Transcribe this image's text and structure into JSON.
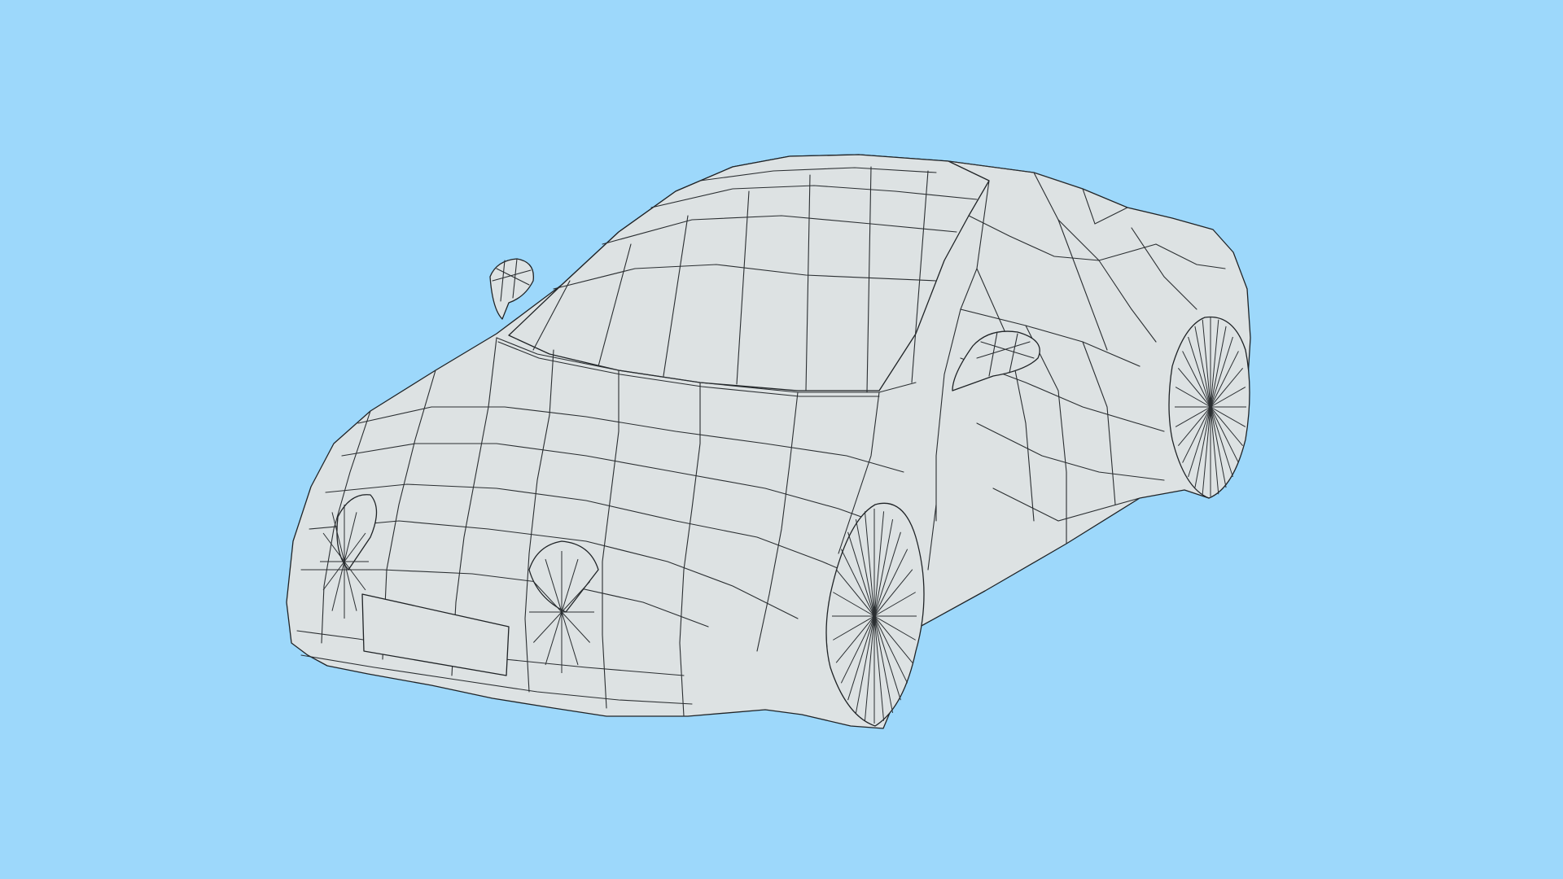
{
  "scene": {
    "background_color": "#9dd8fb",
    "model": {
      "object": "sports-car",
      "shading": "flat",
      "display_mode": "wireframe-on-shaded",
      "surface_color": "#dde2e3",
      "edge_color": "#2a2e31",
      "parts": [
        "body",
        "windshield",
        "roof",
        "hood",
        "front-bumper",
        "license-plate",
        "headlights",
        "side-mirrors",
        "front-wheel",
        "rear-wheel"
      ]
    }
  }
}
